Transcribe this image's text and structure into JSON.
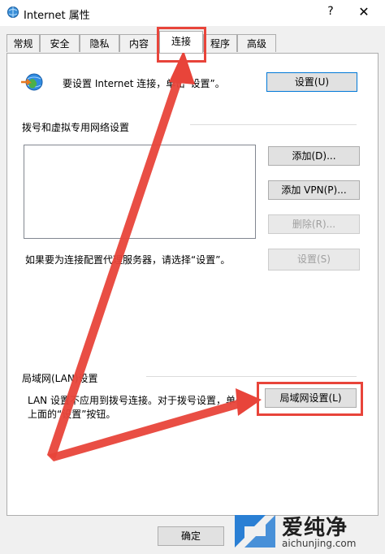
{
  "window": {
    "title": "Internet 属性",
    "help": "?",
    "close": "✕"
  },
  "tabs": [
    {
      "label": "常规"
    },
    {
      "label": "安全"
    },
    {
      "label": "隐私"
    },
    {
      "label": "内容"
    },
    {
      "label": "连接",
      "active": true
    },
    {
      "label": "程序"
    },
    {
      "label": "高级"
    }
  ],
  "setup": {
    "text": "要设置 Internet 连接，单击“设置”。",
    "button": "设置(U)"
  },
  "dialup": {
    "heading": "拨号和虚拟专用网络设置",
    "add": "添加(D)...",
    "add_vpn": "添加 VPN(P)...",
    "remove": "删除(R)...",
    "proxy_text": "如果要为连接配置代理服务器，请选择“设置”。",
    "settings": "设置(S)"
  },
  "lan": {
    "heading": "局域网(LAN)设置",
    "text_line1": "LAN 设置不应用到拨号连接。对于拨号设置，单击",
    "text_line2": "上面的“设置”按钮。",
    "button": "局域网设置(L)"
  },
  "footer": {
    "ok": "确定"
  },
  "watermark": {
    "name": "爱纯净",
    "url": "aichunjing.com"
  },
  "colors": {
    "highlight": "#e8443a",
    "accent": "#0078d7"
  }
}
